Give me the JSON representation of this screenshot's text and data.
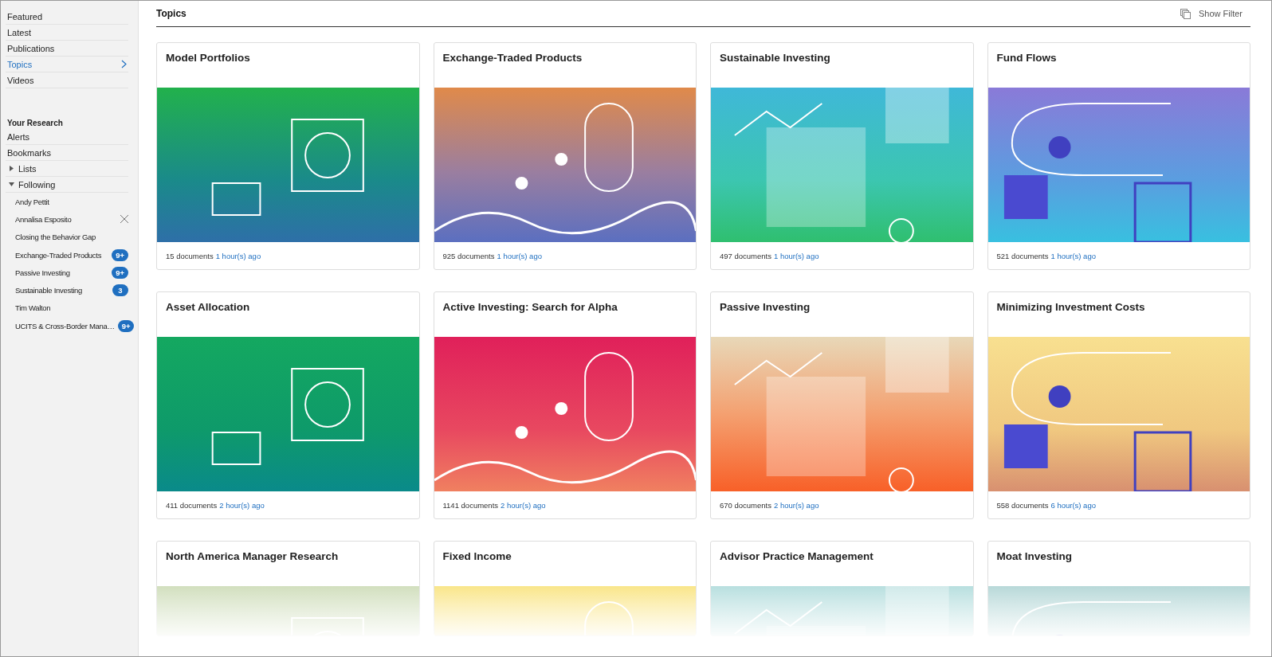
{
  "sidebar": {
    "nav": [
      {
        "label": "Featured",
        "selected": false
      },
      {
        "label": "Latest",
        "selected": false
      },
      {
        "label": "Publications",
        "selected": false
      },
      {
        "label": "Topics",
        "selected": true
      },
      {
        "label": "Videos",
        "selected": false
      }
    ],
    "research": {
      "heading": "Your Research",
      "items": [
        {
          "label": "Alerts",
          "kind": "link"
        },
        {
          "label": "Bookmarks",
          "kind": "link"
        },
        {
          "label": "Lists",
          "kind": "folder",
          "expanded": false
        },
        {
          "label": "Following",
          "kind": "folder",
          "expanded": true,
          "children": [
            {
              "label": "Andy Pettit",
              "removable": false
            },
            {
              "label": "Annalisa Esposito",
              "removable": true
            },
            {
              "label": "Closing the Behavior Gap",
              "removable": false
            },
            {
              "label": "Exchange-Traded Products",
              "badge": "9+",
              "removable": false
            },
            {
              "label": "Passive Investing",
              "badge": "9+",
              "removable": false
            },
            {
              "label": "Sustainable Investing",
              "badge": "3",
              "removable": false
            },
            {
              "label": "Tim Walton",
              "removable": false
            },
            {
              "label": "UCITS & Cross-Border Mana…",
              "badge": "9+",
              "removable": false
            }
          ]
        }
      ]
    }
  },
  "header": {
    "title": "Topics",
    "filter_button": "Show Filter"
  },
  "cards": [
    {
      "title": "Model Portfolios",
      "documents": "15 documents",
      "updated": "1 hour(s) ago"
    },
    {
      "title": "Exchange-Traded Products",
      "documents": "925 documents",
      "updated": "1 hour(s) ago"
    },
    {
      "title": "Sustainable Investing",
      "documents": "497 documents",
      "updated": "1 hour(s) ago"
    },
    {
      "title": "Fund Flows",
      "documents": "521 documents",
      "updated": "1 hour(s) ago"
    },
    {
      "title": "Asset Allocation",
      "documents": "411 documents",
      "updated": "2 hour(s) ago"
    },
    {
      "title": "Active Investing: Search for Alpha",
      "documents": "1141 documents",
      "updated": "2 hour(s) ago"
    },
    {
      "title": "Passive Investing",
      "documents": "670 documents",
      "updated": "2 hour(s) ago"
    },
    {
      "title": "Minimizing Investment Costs",
      "documents": "558 documents",
      "updated": "6 hour(s) ago"
    },
    {
      "title": "North America Manager Research"
    },
    {
      "title": "Fixed Income"
    },
    {
      "title": "Advisor Practice Management"
    },
    {
      "title": "Moat Investing"
    }
  ]
}
